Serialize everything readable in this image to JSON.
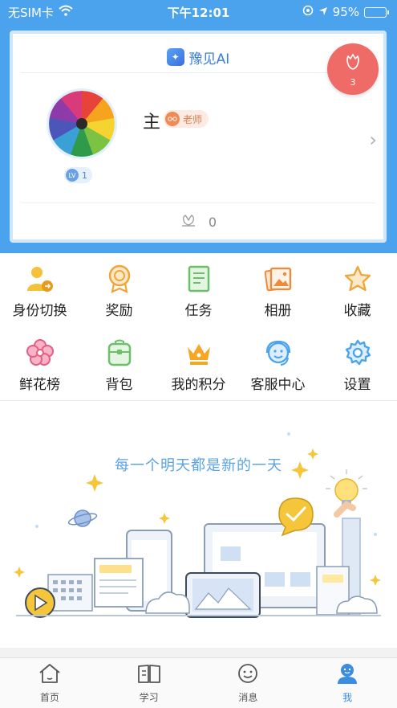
{
  "status_bar": {
    "carrier": "无SIM卡",
    "time": "下午12:01",
    "battery_percent": "95%",
    "battery_level": 0.95
  },
  "profile": {
    "app_name": "豫见AI",
    "user_name": "主",
    "role": "老师",
    "level": "1",
    "flower_count": "0",
    "badge_count": "3"
  },
  "menu": {
    "items": [
      {
        "label": "身份切换",
        "icon": "identity-switch-icon"
      },
      {
        "label": "奖励",
        "icon": "medal-icon"
      },
      {
        "label": "任务",
        "icon": "task-icon"
      },
      {
        "label": "相册",
        "icon": "album-icon"
      },
      {
        "label": "收藏",
        "icon": "star-icon"
      },
      {
        "label": "鲜花榜",
        "icon": "flower-icon"
      },
      {
        "label": "背包",
        "icon": "backpack-icon"
      },
      {
        "label": "我的积分",
        "icon": "crown-icon"
      },
      {
        "label": "客服中心",
        "icon": "customer-service-icon"
      },
      {
        "label": "设置",
        "icon": "settings-gear-icon"
      }
    ]
  },
  "illustration": {
    "slogan": "每一个明天都是新的一天"
  },
  "tabs": [
    {
      "label": "首页",
      "icon": "home-icon"
    },
    {
      "label": "学习",
      "icon": "book-icon"
    },
    {
      "label": "消息",
      "icon": "message-icon"
    },
    {
      "label": "我",
      "icon": "user-icon",
      "active": true
    }
  ],
  "colors": {
    "primary": "#4aa3ec",
    "accent_blue": "#3b8de0",
    "badge_red": "#ef6b68"
  }
}
